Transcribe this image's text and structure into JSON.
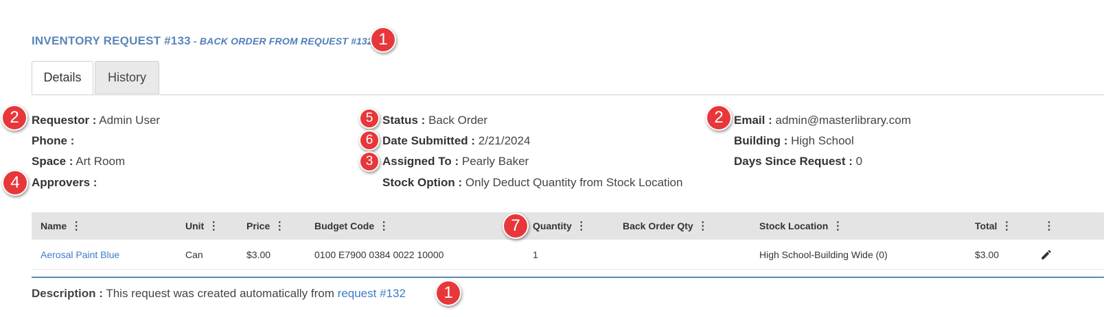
{
  "header": {
    "title": "INVENTORY REQUEST #133",
    "subtitle": " - BACK ORDER FROM REQUEST #132"
  },
  "tabs": [
    {
      "label": "Details",
      "active": true
    },
    {
      "label": "History",
      "active": false
    }
  ],
  "details": {
    "requestor": {
      "label": "Requestor :",
      "value": "Admin User"
    },
    "phone": {
      "label": "Phone :",
      "value": ""
    },
    "space": {
      "label": "Space :",
      "value": "Art Room"
    },
    "approvers": {
      "label": "Approvers :",
      "value": ""
    },
    "status": {
      "label": "Status :",
      "value": "Back Order"
    },
    "date_submitted": {
      "label": "Date Submitted :",
      "value": "2/21/2024"
    },
    "assigned_to": {
      "label": "Assigned To :",
      "value": "Pearly Baker"
    },
    "stock_option": {
      "label": "Stock Option :",
      "value": "Only Deduct Quantity from Stock Location"
    },
    "email": {
      "label": "Email :",
      "value": "admin@masterlibrary.com"
    },
    "building": {
      "label": "Building :",
      "value": "High School"
    },
    "days_since": {
      "label": "Days Since Request :",
      "value": "0"
    }
  },
  "table": {
    "columns": [
      "Name",
      "Unit",
      "Price",
      "Budget Code",
      "Quantity",
      "Back Order Qty",
      "Stock Location",
      "Total",
      ""
    ],
    "column_menu_icon": "⋮",
    "rows": [
      {
        "name": "Aerosal Paint Blue",
        "unit": "Can",
        "price": "$3.00",
        "budget_code": "0100 E7900 0384 0022 10000",
        "quantity": "1",
        "back_order_qty": "",
        "stock_location": "High School-Building Wide (0)",
        "total": "$3.00",
        "action_icon": "pencil-icon"
      }
    ]
  },
  "description": {
    "label": "Description :",
    "text": "This request was created automatically from",
    "link": "request #132"
  },
  "markers": [
    "1",
    "2",
    "2",
    "4",
    "5",
    "6",
    "3",
    "7",
    "1"
  ],
  "colors": {
    "accent": "#5b86b8",
    "link": "#3d7ac7",
    "marker": "#e8373a",
    "table_header": "#e4e4e4"
  }
}
